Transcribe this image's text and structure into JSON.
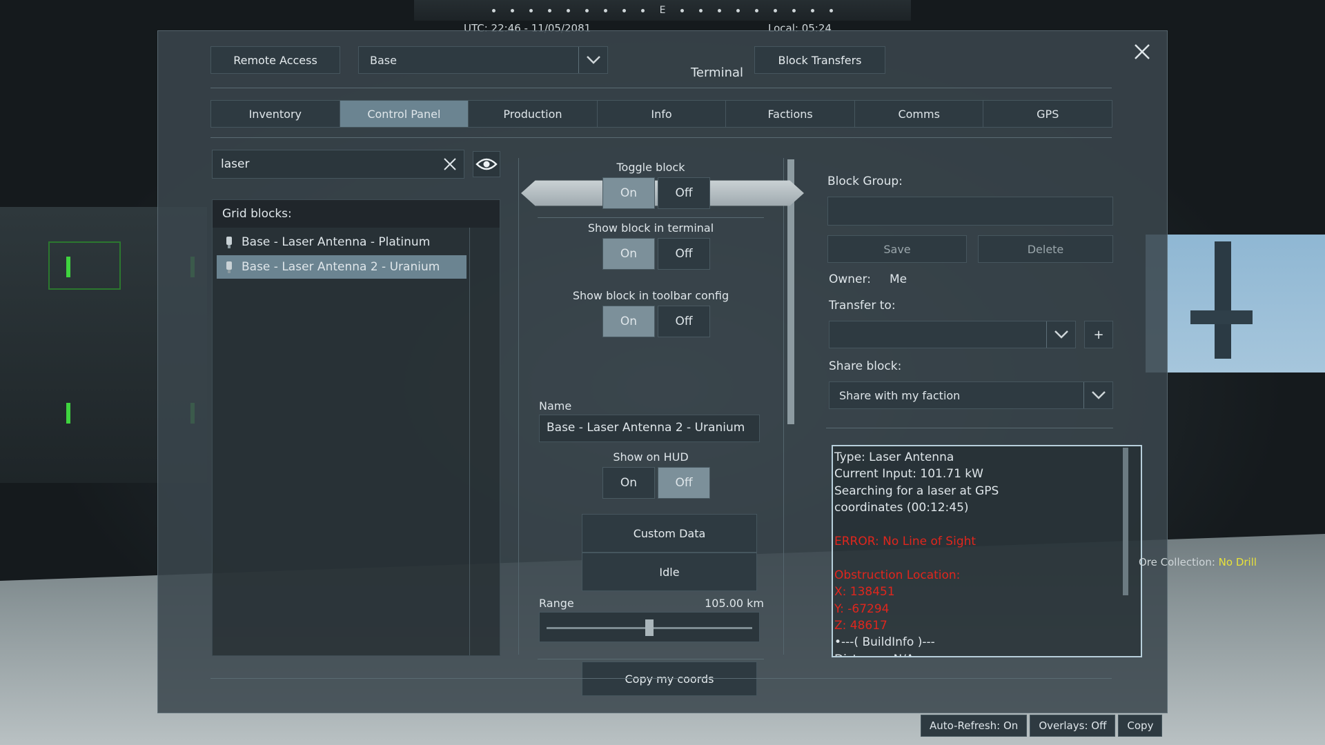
{
  "hud": {
    "compass_letter": "E",
    "utc": "UTC: 22:46 - 11/05/2081",
    "local": "Local: 05:24",
    "ore_label": "Ore Collection:",
    "ore_value": "No Drill"
  },
  "header": {
    "remote_access": "Remote Access",
    "grid_selected": "Base",
    "title": "Terminal",
    "block_transfers": "Block Transfers"
  },
  "tabs": [
    "Inventory",
    "Control Panel",
    "Production",
    "Info",
    "Factions",
    "Comms",
    "GPS"
  ],
  "active_tab": "Control Panel",
  "search": {
    "value": "laser"
  },
  "grid_blocks": {
    "header": "Grid blocks:",
    "items": [
      {
        "label": "Base - Laser Antenna - Platinum",
        "selected": false
      },
      {
        "label": "Base - Laser Antenna 2 - Uranium",
        "selected": true
      }
    ]
  },
  "control": {
    "toggle_block": "Toggle block",
    "show_in_terminal": "Show block in terminal",
    "show_in_toolbar": "Show block in toolbar config",
    "on": "On",
    "off": "Off",
    "name_label": "Name",
    "name_value": "Base - Laser Antenna 2 - Uranium",
    "show_on_hud": "Show on HUD",
    "custom_data": "Custom Data",
    "idle": "Idle",
    "range_label": "Range",
    "range_value": "105.00 km",
    "range_fraction": 0.5,
    "copy_coords": "Copy my coords",
    "states": {
      "toggle_block": "On",
      "show_in_terminal": "On",
      "show_in_toolbar": "On",
      "show_on_hud": "Off"
    }
  },
  "right": {
    "block_group_label": "Block Group:",
    "save": "Save",
    "delete": "Delete",
    "owner_label": "Owner:",
    "owner_value": "Me",
    "transfer_to_label": "Transfer to:",
    "plus": "+",
    "share_block_label": "Share block:",
    "share_value": "Share with my faction",
    "info_lines": [
      {
        "text": "Type: Laser Antenna",
        "error": false
      },
      {
        "text": "Current Input: 101.71 kW",
        "error": false
      },
      {
        "text": "Searching for a laser at GPS",
        "error": false
      },
      {
        "text": "coordinates (00:12:45)",
        "error": false
      },
      {
        "text": "",
        "error": false
      },
      {
        "text": "ERROR: No Line of Sight",
        "error": true
      },
      {
        "text": "",
        "error": false
      },
      {
        "text": "Obstruction Location:",
        "error": true
      },
      {
        "text": "X: 138451",
        "error": true
      },
      {
        "text": "Y: -67294",
        "error": true
      },
      {
        "text": "Z: 48617",
        "error": true
      },
      {
        "text": "•---( BuildInfo )---",
        "error": false
      },
      {
        "text": "Distance: N/A",
        "error": false
      }
    ]
  },
  "footer": {
    "auto_refresh": "Auto-Refresh: On",
    "overlays": "Overlays: Off",
    "copy": "Copy"
  },
  "colors": {
    "active_tab": "#6b8491",
    "error_text": "#e0261d",
    "ore_value": "#e8e23a"
  }
}
